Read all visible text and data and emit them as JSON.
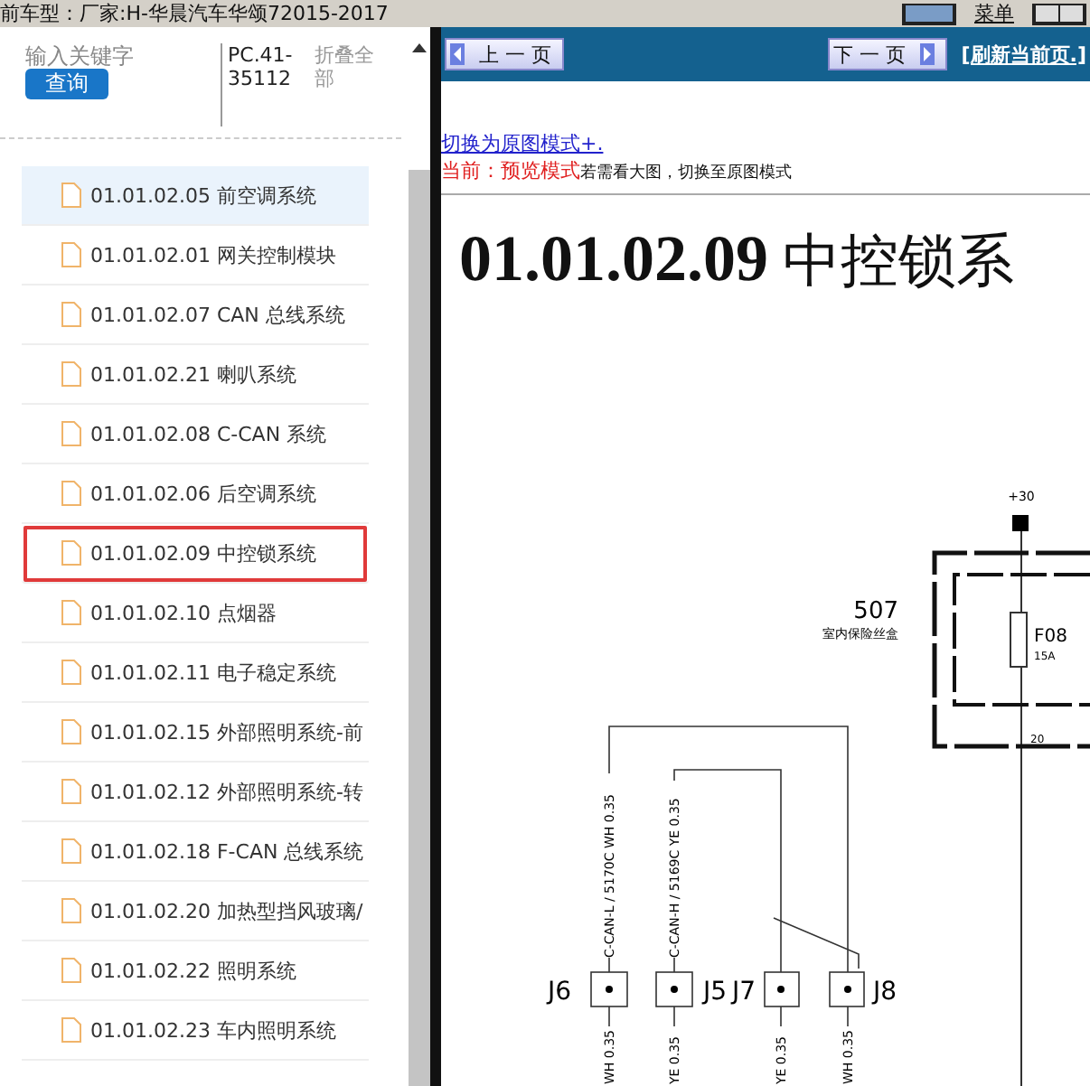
{
  "top_bar": {
    "vehicle": "前车型：厂家:H-华晨汽车华颂72015-2017",
    "menu": "菜单"
  },
  "sidebar": {
    "search": {
      "placeholder": "输入关键字",
      "button": "查询"
    },
    "code": "PC.41-35112",
    "collapse": "折叠全部",
    "items": [
      {
        "label": "01.01.02.05 前空调系统",
        "selected": true,
        "outlined": false
      },
      {
        "label": "01.01.02.01 网关控制模块",
        "selected": false,
        "outlined": false
      },
      {
        "label": "01.01.02.07 CAN 总线系统",
        "selected": false,
        "outlined": false
      },
      {
        "label": "01.01.02.21 喇叭系统",
        "selected": false,
        "outlined": false
      },
      {
        "label": "01.01.02.08 C-CAN 系统",
        "selected": false,
        "outlined": false
      },
      {
        "label": "01.01.02.06 后空调系统",
        "selected": false,
        "outlined": false
      },
      {
        "label": "01.01.02.09 中控锁系统",
        "selected": false,
        "outlined": true
      },
      {
        "label": "01.01.02.10 点烟器",
        "selected": false,
        "outlined": false
      },
      {
        "label": "01.01.02.11 电子稳定系统",
        "selected": false,
        "outlined": false
      },
      {
        "label": "01.01.02.15 外部照明系统-前",
        "selected": false,
        "outlined": false
      },
      {
        "label": "01.01.02.12 外部照明系统-转",
        "selected": false,
        "outlined": false
      },
      {
        "label": "01.01.02.18 F-CAN 总线系统",
        "selected": false,
        "outlined": false
      },
      {
        "label": "01.01.02.20 加热型挡风玻璃/",
        "selected": false,
        "outlined": false
      },
      {
        "label": "01.01.02.22 照明系统",
        "selected": false,
        "outlined": false
      },
      {
        "label": "01.01.02.23 车内照明系统",
        "selected": false,
        "outlined": false
      }
    ]
  },
  "nav": {
    "prev": "上 一 页",
    "next": "下 一 页",
    "refresh": "[刷新当前页.]"
  },
  "mode_link": "切换为原图模式+.",
  "mode_status": {
    "label": "当前：预览模式",
    "hint": "若需看大图，切换至原图模式"
  },
  "heading": {
    "number": "01.01.02.09",
    "title": "中控锁系"
  },
  "diagram": {
    "supply": "+30",
    "fuse_box": {
      "number": "507",
      "name": "室内保险丝盒"
    },
    "fuse": {
      "id": "F08",
      "rating": "15A"
    },
    "pin": "20",
    "connectors": [
      {
        "id": "J6",
        "wire_top": "C-CAN-L / 5170C WH 0.35",
        "wire_bottom": "WH 0.35"
      },
      {
        "id": "J5",
        "wire_top": "C-CAN-H / 5169C YE 0.35",
        "wire_bottom": "YE 0.35"
      },
      {
        "id": "J7",
        "wire_bottom": "YE 0.35"
      },
      {
        "id": "J8",
        "wire_bottom": "WH 0.35"
      }
    ]
  }
}
